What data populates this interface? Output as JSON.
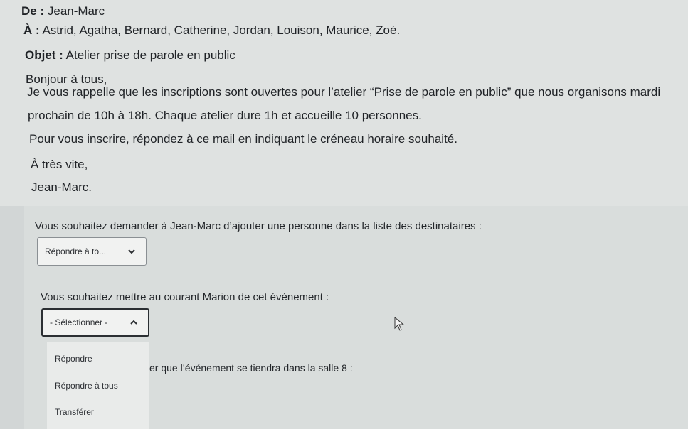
{
  "email": {
    "from_label": "De :",
    "from_value": "Jean-Marc",
    "to_label": "À :",
    "to_value": "Astrid, Agatha, Bernard, Catherine, Jordan, Louison, Maurice, Zoé.",
    "subject_label": "Objet :",
    "subject_value": "Atelier prise de parole en public",
    "greeting": "Bonjour à tous,",
    "body_line1": "Je vous rappelle que les inscriptions sont ouvertes pour l’atelier “Prise de parole en public” que nous organisons mardi",
    "body_line2": "prochain de 10h à 18h. Chaque atelier dure 1h et accueille 10 personnes.",
    "body_line3": "Pour vous inscrire, répondez à ce mail en indiquant le créneau horaire souhaité.",
    "closing": "À très vite,",
    "signature": "Jean-Marc."
  },
  "quiz": {
    "q1": "Vous souhaitez demander à Jean-Marc d’ajouter une personne dans la liste des destinataires :",
    "select1": "Répondre à to...",
    "q2": "Vous souhaitez mettre au courant Marion de cet événement :",
    "select2": "- Sélectionner -",
    "q3_partial": "er que l’événement se tiendra dans la salle 8 :",
    "options": [
      "Répondre",
      "Répondre à tous",
      "Transférer"
    ]
  }
}
